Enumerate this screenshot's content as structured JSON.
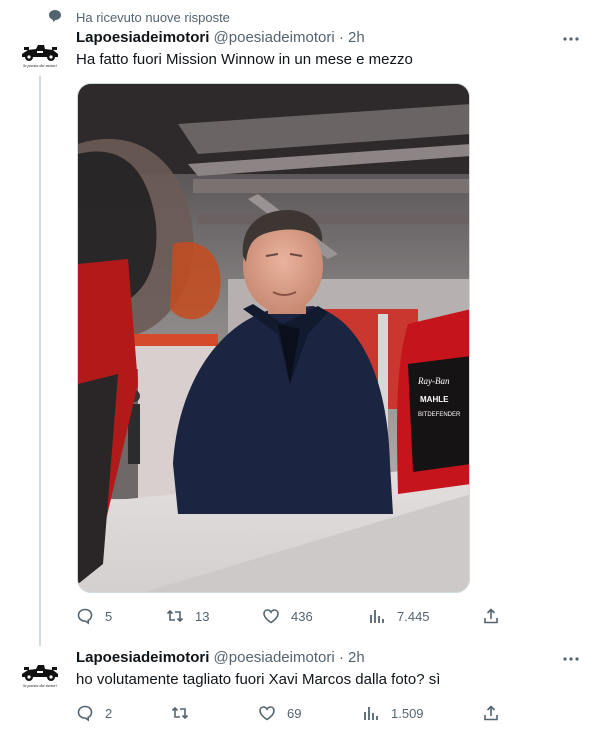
{
  "notification": {
    "text": "Ha ricevuto nuove risposte",
    "icon": "chat-bubble-icon"
  },
  "tweets": [
    {
      "author": {
        "name": "Lapoesiadeimotori",
        "handle": "@poesiadeimotori",
        "separator": "·",
        "time": "2h",
        "avatar_caption": "la poesia dei motori"
      },
      "text": "Ha fatto fuori Mission Winnow in un mese e mezzo",
      "photo": {
        "sponsor_lines": [
          "Ray-Ban",
          "MAHLE",
          "BITDEFENDER"
        ]
      },
      "stats": {
        "replies": "5",
        "retweets": "13",
        "likes": "436",
        "views": "7.445"
      }
    },
    {
      "author": {
        "name": "Lapoesiadeimotori",
        "handle": "@poesiadeimotori",
        "separator": "·",
        "time": "2h",
        "avatar_caption": "la poesia dei motori"
      },
      "text": "ho volutamente tagliato fuori Xavi Marcos dalla foto? sì",
      "stats": {
        "replies": "2",
        "retweets": "",
        "likes": "69",
        "views": "1.509"
      }
    }
  ],
  "colors": {
    "text": "#0f1419",
    "muted": "#536471",
    "line": "#cfd9de",
    "ferrari_red": "#d3121b",
    "navy_coat": "#1b2440"
  }
}
